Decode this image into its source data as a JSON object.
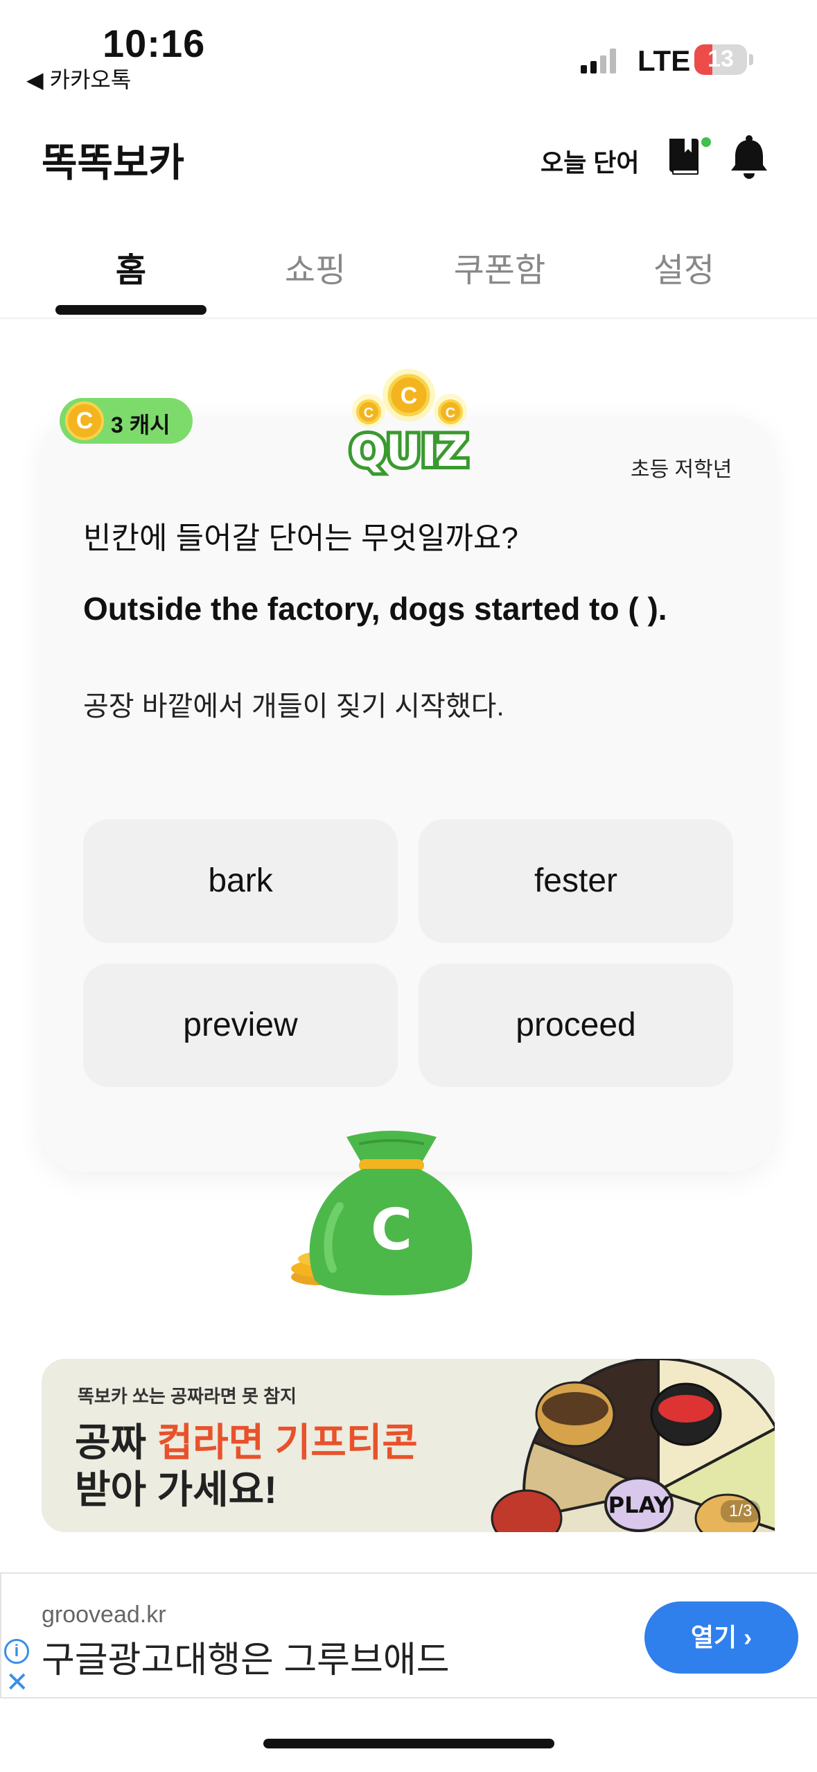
{
  "status_bar": {
    "time": "10:16",
    "back_label": "◀ 카카오톡",
    "network": "LTE",
    "battery": "13",
    "battery_level": 0.13,
    "battery_color": "#ee4b4b"
  },
  "header": {
    "title": "똑똑보카",
    "today_word": "오늘 단어",
    "book_icon": "book-icon",
    "bell_icon": "bell-icon"
  },
  "tabs": [
    {
      "label": "홈",
      "active": true
    },
    {
      "label": "쇼핑",
      "active": false
    },
    {
      "label": "쿠폰함",
      "active": false
    },
    {
      "label": "설정",
      "active": false
    }
  ],
  "quiz": {
    "cash_coin": "C",
    "cash_label": "3 캐시",
    "logo_text": "QUIZ",
    "level": "초등 저학년",
    "prompt": "빈칸에 들어갈 단어는 무엇일까요?",
    "sentence": "Outside the factory, dogs started to (              ).",
    "translation": "공장 바깥에서 개들이 짖기 시작했다.",
    "options": [
      "bark",
      "fester",
      "preview",
      "proceed"
    ]
  },
  "reward": {
    "bag_letter": "C",
    "bag_color": "#4cb84a"
  },
  "banner": {
    "small_text": "똑보카 쏘는 공짜라면 못 참지",
    "line1_a": "공짜 ",
    "line1_b": "컵라면 기프티콘",
    "line2": "받아 가세요!",
    "play": "PLAY",
    "page": "1/3"
  },
  "ad": {
    "domain": "groovead.kr",
    "title": "구글광고대행은 그루브애드",
    "button": "열기",
    "info_glyph": "i",
    "close_glyph": "✕"
  }
}
